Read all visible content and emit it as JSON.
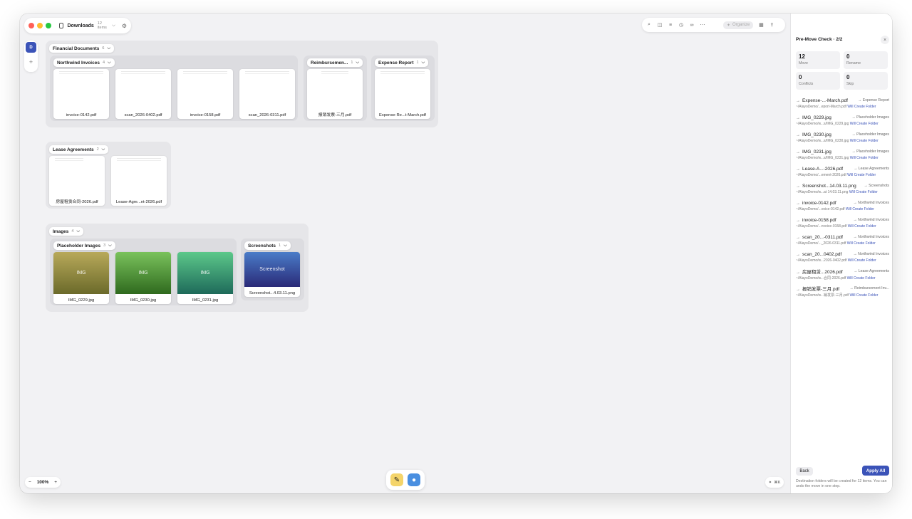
{
  "window": {
    "title": "Downloads",
    "item_count": "12 items"
  },
  "toolbar": {
    "organize_label": "Organize"
  },
  "rail": {
    "avatar_letter": "D",
    "add": "+"
  },
  "canvas": {
    "groups": [
      {
        "label": "Financial Documents",
        "count": "6",
        "subgroups": [
          {
            "label": "Northwind Invoices",
            "count": "4",
            "files": [
              "invoice-0142.pdf",
              "scan_2026-0402.pdf",
              "invoice-0158.pdf",
              "scan_2026-0311.pdf"
            ]
          },
          {
            "label": "Reimbursemen...",
            "count": "1",
            "files": [
              "报销发票-三月.pdf"
            ]
          },
          {
            "label": "Expense Report",
            "count": "1",
            "files": [
              "Expense-Re...t-March.pdf"
            ]
          }
        ]
      },
      {
        "label": "Lease Agreements",
        "count": "2",
        "files": [
          "房屋租赁合同-2026.pdf",
          "Lease-Agre...nt-2026.pdf"
        ]
      },
      {
        "label": "Images",
        "count": "4",
        "subgroups": [
          {
            "label": "Placeholder Images",
            "count": "3",
            "files": [
              "IMG_0229.jpg",
              "IMG_0230.jpg",
              "IMG_0231.jpg"
            ],
            "preview_text": "IMG"
          },
          {
            "label": "Screenshots",
            "count": "1",
            "files": [
              "Screenshot...4.03.11.png"
            ],
            "preview_text": "Screenshot"
          }
        ]
      }
    ]
  },
  "zoom": {
    "minus": "−",
    "value": "100%",
    "plus": "+"
  },
  "shortcut": {
    "label": "⌘K"
  },
  "panel": {
    "title": "Pre-Move Check · 2/2",
    "stats": [
      {
        "value": "12",
        "label": "Move"
      },
      {
        "value": "0",
        "label": "Rename"
      },
      {
        "value": "0",
        "label": "Conflicts"
      },
      {
        "value": "0",
        "label": "Skip"
      }
    ],
    "moves": [
      {
        "name": "Expense-...-March.pdf",
        "dest": "→ Expense Report",
        "path": "~/AlayoDemo/...eport-March.pdf",
        "action": "Will Create Folder"
      },
      {
        "name": "IMG_0229.jpg",
        "dest": "→ Placeholder Images",
        "path": "~/AlayoDemo/w...s/IMG_0229.jpg",
        "action": "Will Create Folder"
      },
      {
        "name": "IMG_0230.jpg",
        "dest": "→ Placeholder Images",
        "path": "~/AlayoDemo/w...s/IMG_0230.jpg",
        "action": "Will Create Folder"
      },
      {
        "name": "IMG_0231.jpg",
        "dest": "→ Placeholder Images",
        "path": "~/AlayoDemo/w...s/IMG_0231.jpg",
        "action": "Will Create Folder"
      },
      {
        "name": "Lease-A...-2026.pdf",
        "dest": "→ Lease Agreements",
        "path": "~/AlayoDemo/...ement-2026.pdf",
        "action": "Will Create Folder"
      },
      {
        "name": "Screenshot...14.03.11.png",
        "dest": "→ Screenshots",
        "path": "~/AlayoDemo/w...at 14.03.11.png",
        "action": "Will Create Folder"
      },
      {
        "name": "invoice-0142.pdf",
        "dest": "→ Northwind Invoices",
        "path": "~/AlayoDemo/...voice-0142.pdf",
        "action": "Will Create Folder"
      },
      {
        "name": "invoice-0158.pdf",
        "dest": "→ Northwind Invoices",
        "path": "~/AlayoDemo/...nvoice-0158.pdf",
        "action": "Will Create Folder"
      },
      {
        "name": "scan_20...-0311.pdf",
        "dest": "→ Northwind Invoices",
        "path": "~/AlayoDemo/..._2026-0311.pdf",
        "action": "Will Create Folder"
      },
      {
        "name": "scan_20...0402.pdf",
        "dest": "→ Northwind Invoices",
        "path": "~/AlayoDemo/w...2026-0402.pdf",
        "action": "Will Create Folder"
      },
      {
        "name": "房屋租赁...2026.pdf",
        "dest": "→ Lease Agreements",
        "path": "~/AlayoDemo/w...合同-2026.pdf",
        "action": "Will Create Folder"
      },
      {
        "name": "报销发票-三月.pdf",
        "dest": "→ Reimbursement Inv...",
        "path": "~/AlayoDemo/w...销发票-三月.pdf",
        "action": "Will Create Folder"
      }
    ],
    "back_label": "Back",
    "apply_label": "Apply All",
    "note": "Destination folders will be created for 12 items. You can undo the move in one step."
  },
  "colors": {
    "accent": "#3b53b8",
    "traffic_red": "#ff5f57",
    "traffic_yellow": "#febc2e",
    "traffic_green": "#28c840"
  },
  "icons": [
    "folder-icon",
    "chevron-down-icon",
    "gear-icon",
    "search-icon",
    "sidebar-icon",
    "filter-icon",
    "clock-icon",
    "link-icon",
    "more-icon",
    "sparkle-icon",
    "grid-icon",
    "share-icon",
    "close-icon",
    "arrow-right-icon"
  ]
}
